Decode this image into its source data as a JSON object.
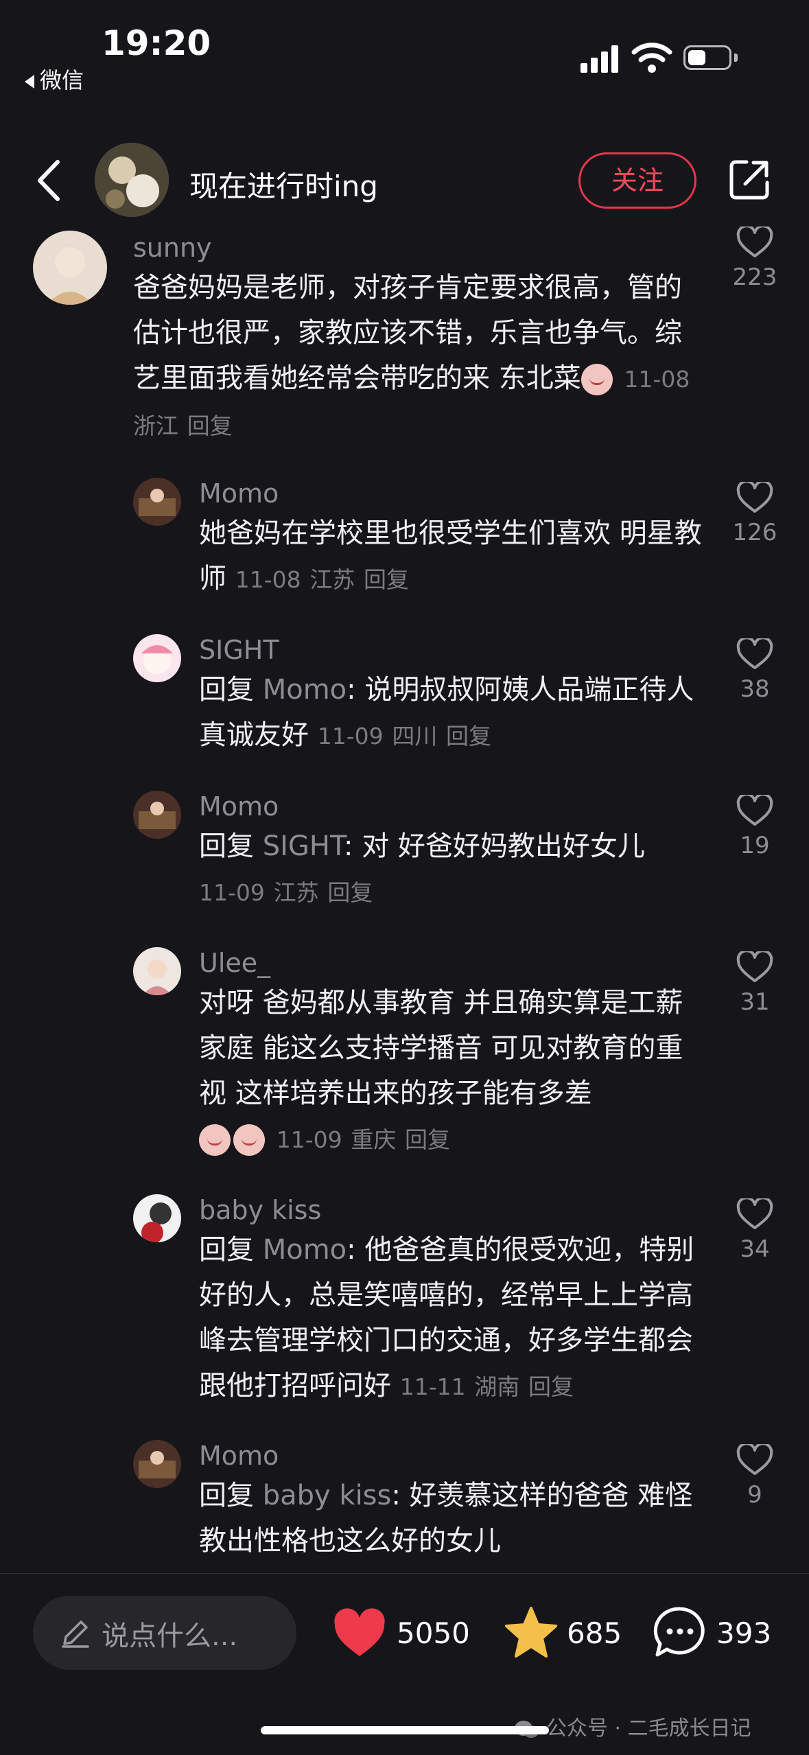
{
  "status_bar": {
    "time": "19:20",
    "back_app": "微信",
    "battery_level": 0.45
  },
  "header": {
    "author_name": "现在进行时ing",
    "follow_label": "关注"
  },
  "comments": [
    {
      "user": "sunny",
      "reply_prefix": "",
      "reply_to": "",
      "text": "爸爸妈妈是老师，对孩子肯定要求很高，管的估计也很严，家教应该不错，乐言也争气。综艺里面我看她经常会带吃的来 东北菜",
      "date": "11-08",
      "location": "浙江",
      "reply_label": "回复",
      "likes": "223"
    },
    {
      "user": "Momo",
      "reply_prefix": "",
      "reply_to": "",
      "text": "她爸妈在学校里也很受学生们喜欢 明星教师",
      "date": "11-08",
      "location": "江苏",
      "reply_label": "回复",
      "likes": "126"
    },
    {
      "user": "SIGHT",
      "reply_prefix": "回复 ",
      "reply_to": "Momo",
      "text": ": 说明叔叔阿姨人品端正待人真诚友好",
      "date": "11-09",
      "location": "四川",
      "reply_label": "回复",
      "likes": "38"
    },
    {
      "user": "Momo",
      "reply_prefix": "回复 ",
      "reply_to": "SIGHT",
      "text": ": 对 好爸好妈教出好女儿",
      "date": "11-09",
      "location": "江苏",
      "reply_label": "回复",
      "likes": "19"
    },
    {
      "user": "Ulee_",
      "reply_prefix": "",
      "reply_to": "",
      "text": "对呀 爸妈都从事教育 并且确实算是工薪家庭 能这么支持学播音 可见对教育的重视 这样培养出来的孩子能有多差",
      "date": "11-09",
      "location": "重庆",
      "reply_label": "回复",
      "likes": "31"
    },
    {
      "user": "baby kiss",
      "reply_prefix": "回复 ",
      "reply_to": "Momo",
      "text": ": 他爸爸真的很受欢迎，特别好的人，总是笑嘻嘻的，经常早上上学高峰去管理学校门口的交通，好多学生都会跟他打招呼问好",
      "date": "11-11",
      "location": "湖南",
      "reply_label": "回复",
      "likes": "34"
    },
    {
      "user": "Momo",
      "reply_prefix": "回复 ",
      "reply_to": "baby kiss",
      "text": ": 好羡慕这样的爸爸 难怪教出性格也这么好的女儿",
      "date": "",
      "location": "",
      "reply_label": "",
      "likes": "9"
    }
  ],
  "bottom_bar": {
    "input_placeholder": "说点什么...",
    "likes": "5050",
    "favorites": "685",
    "comments": "393",
    "watermark": "公众号 · 二毛成长日记"
  },
  "colors": {
    "accent": "#ff4a5e",
    "heart": "#ef3a4c",
    "star": "#f5c04a"
  }
}
